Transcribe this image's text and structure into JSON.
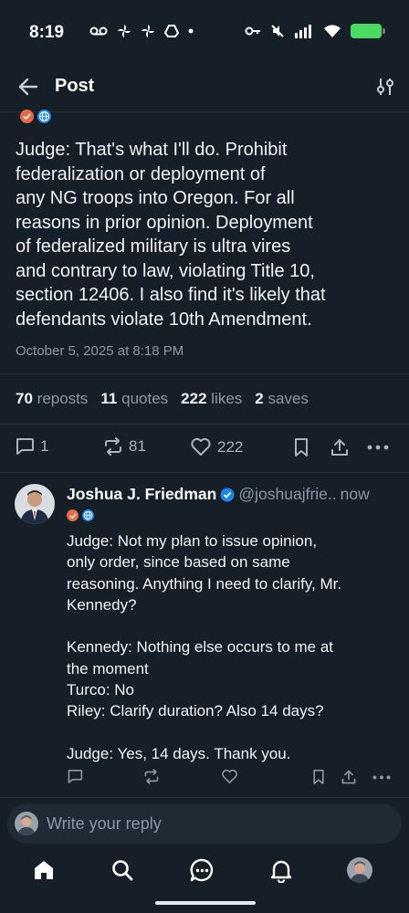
{
  "status_bar": {
    "time": "8:19"
  },
  "header": {
    "title": "Post"
  },
  "post": {
    "text": "Judge: That's what I'll do. Prohibit\nfederalization or deployment of\nany NG troops into Oregon. For all\nreasons in prior opinion. Deployment\nof federalized military is ultra vires\nand contrary to law, violating Title 10,\nsection 12406. I also find it's likely that\ndefendants violate 10th Amendment.",
    "date": "October 5, 2025 at 8:18 PM",
    "stats": {
      "reposts_count": "70",
      "reposts_label": "reposts",
      "quotes_count": "11",
      "quotes_label": "quotes",
      "likes_count": "222",
      "likes_label": "likes",
      "saves_count": "2",
      "saves_label": "saves"
    },
    "actions": {
      "replies": "1",
      "reposts": "81",
      "likes": "222"
    }
  },
  "reply": {
    "author_name": "Joshua J. Friedman",
    "handle": "@joshuajfrie..",
    "time": "now",
    "text": "Judge: Not my plan to issue opinion,\nonly order, since based on same\nreasoning. Anything I need to clarify, Mr.\nKennedy?\n\nKennedy: Nothing else occurs to me at\nthe moment\nTurco: No\nRiley: Clarify duration? Also 14 days?\n\nJudge: Yes, 14 days. Thank you."
  },
  "composer": {
    "placeholder": "Write your reply"
  },
  "colors": {
    "background": "#161e27",
    "accent": "#1e88e5",
    "muted": "#8b98a5",
    "battery": "#4cd964"
  }
}
